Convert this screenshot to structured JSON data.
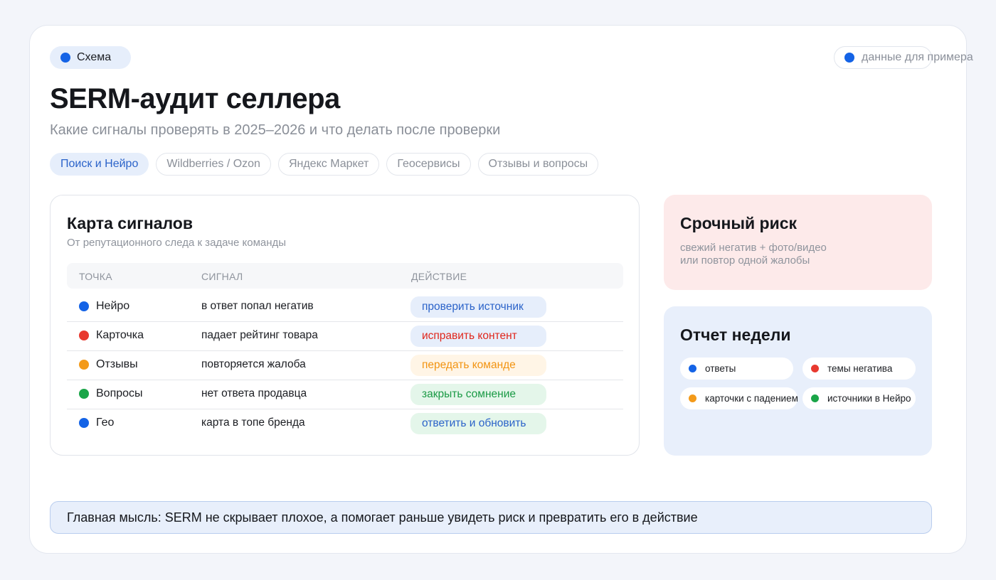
{
  "badge": {
    "label": "Схема",
    "color": "#1463e6"
  },
  "example_badge": {
    "label": "данные для примера",
    "color": "#1463e6"
  },
  "header": {
    "title": "SERM-аудит селлера",
    "subtitle": "Какие сигналы проверять в 2025–2026 и что делать после проверки"
  },
  "tabs": [
    {
      "label": "Поиск и Нейро",
      "active": true
    },
    {
      "label": "Wildberries / Ozon",
      "active": false
    },
    {
      "label": "Яндекс Маркет",
      "active": false
    },
    {
      "label": "Геосервисы",
      "active": false
    },
    {
      "label": "Отзывы и вопросы",
      "active": false
    }
  ],
  "signal_map": {
    "title": "Карта сигналов",
    "subtitle": "От репутационного следа к задаче команды",
    "columns": [
      "ТОЧКА",
      "СИГНАЛ",
      "ДЕЙСТВИЕ"
    ],
    "rows": [
      {
        "point": "Нейро",
        "signal": "в ответ попал негатив",
        "action": "проверить источник",
        "dot": "#1463e6",
        "action_bg": "#e6eefb",
        "action_fg": "#2b63c9"
      },
      {
        "point": "Карточка",
        "signal": "падает рейтинг товара",
        "action": "исправить контент",
        "dot": "#e8392f",
        "action_bg": "#e6eefb",
        "action_fg": "#e0261c"
      },
      {
        "point": "Отзывы",
        "signal": "повторяется жалоба",
        "action": "передать команде",
        "dot": "#f39a1a",
        "action_bg": "#fff5e6",
        "action_fg": "#f29412"
      },
      {
        "point": "Вопросы",
        "signal": "нет ответа продавца",
        "action": "закрыть сомнение",
        "dot": "#1aa548",
        "action_bg": "#e4f6ea",
        "action_fg": "#1a9a45"
      },
      {
        "point": "Гео",
        "signal": "карта в топе бренда",
        "action": "ответить и обновить",
        "dot": "#1463e6",
        "action_bg": "#e4f6ea",
        "action_fg": "#2b63c9"
      }
    ]
  },
  "urgent_risk": {
    "title": "Срочный риск",
    "line1": "свежий негатив + фото/видео",
    "line2": "или повтор одной жалобы"
  },
  "weekly_report": {
    "title": "Отчет недели",
    "chips": [
      {
        "label": "ответы",
        "color": "#1463e6"
      },
      {
        "label": "темы негатива",
        "color": "#e8392f"
      },
      {
        "label": "карточки с падением",
        "color": "#f39a1a"
      },
      {
        "label": "источники в Нейро",
        "color": "#1aa548"
      }
    ]
  },
  "main_thought": "Главная мысль: SERM не скрывает плохое, а помогает раньше увидеть риск и превратить его в действие"
}
